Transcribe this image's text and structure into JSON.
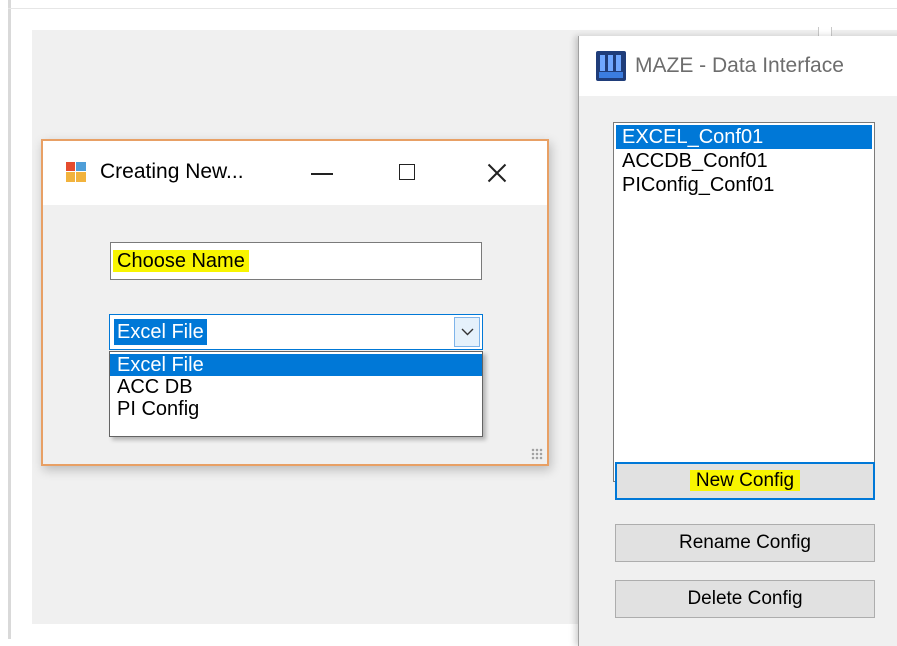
{
  "main_window": {
    "title": "MAZE - Data Interface",
    "configs": [
      "EXCEL_Conf01",
      "ACCDB_Conf01",
      "PIConfig_Conf01"
    ],
    "selected_config": "EXCEL_Conf01",
    "buttons": {
      "new": "New Config",
      "rename": "Rename Config",
      "delete": "Delete Config"
    }
  },
  "dialog": {
    "title": "Creating New...",
    "name_input_value": "Choose Name",
    "combo_value": "Excel File",
    "options": [
      "Excel File",
      "ACC DB",
      "PI Config"
    ],
    "selected_option": "Excel File"
  },
  "colors": {
    "highlight": "#f8f500",
    "selection": "#0078d7",
    "dialog_border": "#e8a065"
  }
}
